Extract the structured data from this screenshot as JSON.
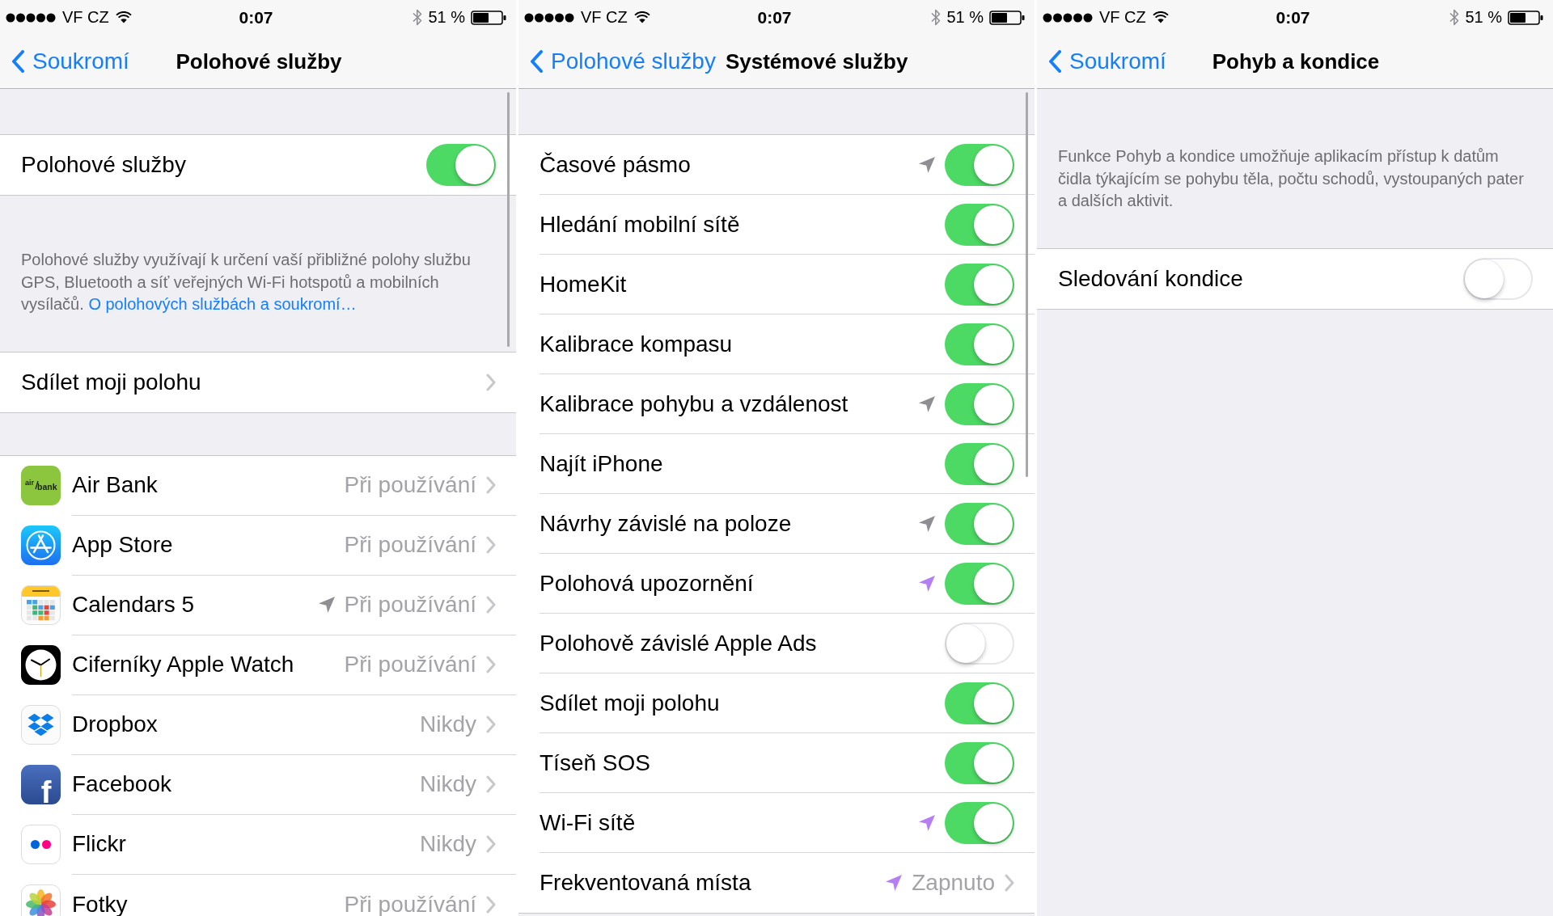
{
  "screens": [
    {
      "status_bar": {
        "carrier": "VF CZ",
        "time": "0:07",
        "battery": "51 %"
      },
      "nav_bar": {
        "back": "Soukromí",
        "title": "Polohové služby"
      },
      "scroll_indicator": true,
      "blocks": [
        {
          "kind": "group",
          "rows": [
            {
              "kind": "toggle",
              "label": "Polohové služby",
              "on": true
            }
          ]
        },
        {
          "kind": "footer",
          "text": "Polohové služby využívají k určení vaší přibližné polohy službu GPS, Bluetooth a síť veřejných Wi-Fi hotspotů a mobilních vysílačů.",
          "link": "O polohových službách a soukromí…"
        },
        {
          "kind": "group",
          "rows": [
            {
              "kind": "link",
              "label": "Sdílet moji polohu"
            }
          ]
        },
        {
          "kind": "group",
          "rows": [
            {
              "kind": "app",
              "logo_text": [
                "air",
                "bank"
              ],
              "label": "Air Bank",
              "value": "Při používání"
            },
            {
              "kind": "app",
              "label": "App Store",
              "value": "Při používání"
            },
            {
              "kind": "app",
              "label": "Calendars 5",
              "value": "Při používání",
              "location_icon": {
                "color": "#8e8e93"
              }
            },
            {
              "kind": "app",
              "label": "Ciferníky Apple Watch",
              "value": "Při používání"
            },
            {
              "kind": "app",
              "label": "Dropbox",
              "value": "Nikdy"
            },
            {
              "kind": "app",
              "logo_text": [
                "f"
              ],
              "label": "Facebook",
              "value": "Nikdy"
            },
            {
              "kind": "app",
              "label": "Flickr",
              "value": "Nikdy"
            },
            {
              "kind": "app",
              "label": "Fotky",
              "value": "Při používání"
            }
          ]
        }
      ]
    },
    {
      "status_bar": {
        "carrier": "VF CZ",
        "time": "0:07",
        "battery": "51 %"
      },
      "nav_bar": {
        "back": "Polohové služby",
        "title": "Systémové služby"
      },
      "scroll_indicator": true,
      "blocks": [
        {
          "kind": "group",
          "rows": [
            {
              "kind": "toggle",
              "label": "Časové pásmo",
              "on": true,
              "location_icon": {
                "color": "#8e8e93"
              }
            },
            {
              "kind": "toggle",
              "label": "Hledání mobilní sítě",
              "on": true
            },
            {
              "kind": "toggle",
              "label": "HomeKit",
              "on": true
            },
            {
              "kind": "toggle",
              "label": "Kalibrace kompasu",
              "on": true
            },
            {
              "kind": "toggle",
              "label": "Kalibrace pohybu a vzdálenost",
              "on": true,
              "location_icon": {
                "color": "#8e8e93"
              }
            },
            {
              "kind": "toggle",
              "label": "Najít iPhone",
              "on": true
            },
            {
              "kind": "toggle",
              "label": "Návrhy závislé na poloze",
              "on": true,
              "location_icon": {
                "color": "#8e8e93"
              }
            },
            {
              "kind": "toggle",
              "label": "Polohová upozornění",
              "on": true,
              "location_icon": {
                "color": "#b57ff3"
              }
            },
            {
              "kind": "toggle",
              "label": "Polohově závislé Apple Ads",
              "on": false
            },
            {
              "kind": "toggle",
              "label": "Sdílet moji polohu",
              "on": true
            },
            {
              "kind": "toggle",
              "label": "Tíseň SOS",
              "on": true
            },
            {
              "kind": "toggle",
              "label": "Wi-Fi sítě",
              "on": true,
              "location_icon": {
                "color": "#b57ff3"
              }
            },
            {
              "kind": "link",
              "label": "Frekventovaná místa",
              "value": "Zapnuto",
              "location_icon": {
                "color": "#b57ff3"
              }
            }
          ]
        }
      ]
    },
    {
      "status_bar": {
        "carrier": "VF CZ",
        "time": "0:07",
        "battery": "51 %"
      },
      "nav_bar": {
        "back": "Soukromí",
        "title": "Pohyb a kondice"
      },
      "blocks": [
        {
          "kind": "footer",
          "text": "Funkce Pohyb a kondice umožňuje aplikacím přístup k datům čidla týkajícím se pohybu těla, počtu schodů, vystoupaných pater a dalších aktivit."
        },
        {
          "kind": "group",
          "rows": [
            {
              "kind": "toggle",
              "label": "Sledování kondice",
              "on": false
            }
          ]
        }
      ]
    }
  ]
}
